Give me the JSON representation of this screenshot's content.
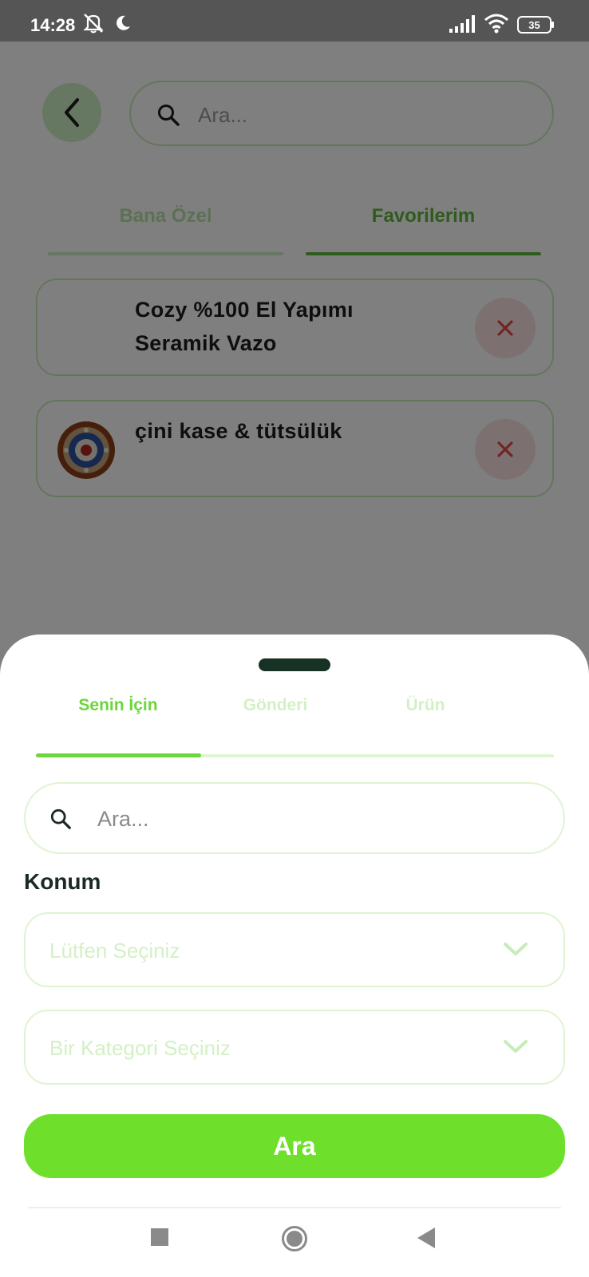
{
  "status_bar": {
    "time": "14:28",
    "battery": "35",
    "icons": [
      "mute-icon",
      "moon-icon",
      "signal-icon",
      "wifi-icon",
      "battery-icon"
    ]
  },
  "background": {
    "search_placeholder": "Ara...",
    "tabs": [
      {
        "label": "Bana Özel",
        "active": false
      },
      {
        "label": "Favorilerim",
        "active": true
      }
    ],
    "favorites": [
      {
        "title": "Cozy %100 El Yapımı Seramik Vazo",
        "has_image": false
      },
      {
        "title": "çini kase & tütsülük",
        "has_image": true
      }
    ]
  },
  "sheet": {
    "tabs": [
      {
        "label": "Senin İçin",
        "active": true
      },
      {
        "label": "Gönderi",
        "active": false
      },
      {
        "label": "Ürün",
        "active": false
      }
    ],
    "search_placeholder": "Ara...",
    "location_label": "Konum",
    "location_select": "Lütfen Seçiniz",
    "category_select": "Bir Kategori Seçiniz",
    "search_button": "Ara"
  },
  "colors": {
    "accent": "#6ee02c",
    "accent_dark": "#5fb63a",
    "light_green": "#dff4d3",
    "remove_red": "#e04a4a"
  }
}
